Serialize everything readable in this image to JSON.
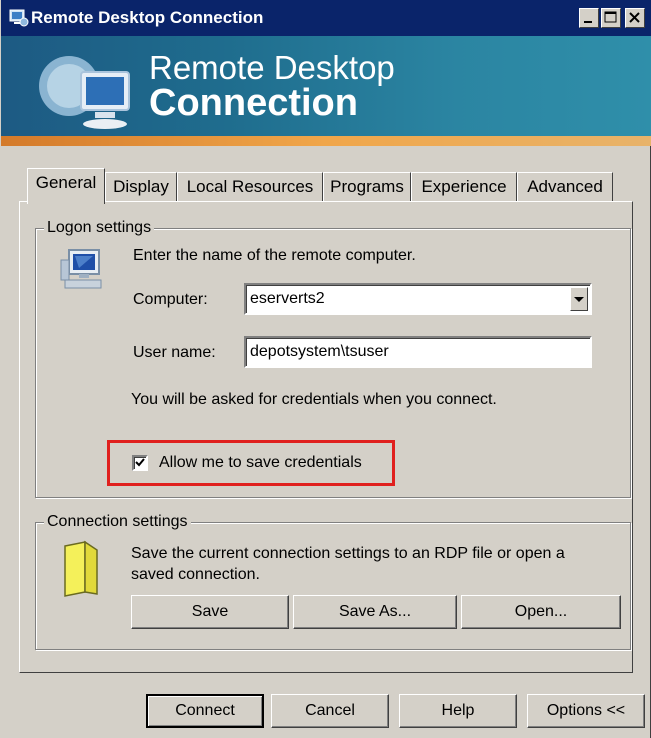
{
  "window": {
    "title": "Remote Desktop Connection",
    "banner_line1": "Remote Desktop",
    "banner_line2": "Connection",
    "controls": {
      "minimize_icon": "minimize-icon",
      "maximize_icon": "maximize-icon",
      "close_icon": "close-icon"
    }
  },
  "tabs": [
    {
      "label": "General",
      "active": true
    },
    {
      "label": "Display"
    },
    {
      "label": "Local Resources"
    },
    {
      "label": "Programs"
    },
    {
      "label": "Experience"
    },
    {
      "label": "Advanced"
    }
  ],
  "logon": {
    "group_label": "Logon settings",
    "intro": "Enter the name of the remote computer.",
    "computer_label": "Computer:",
    "computer_value": "eserverts2",
    "username_label": "User name:",
    "username_value": "depotsystem\\tsuser",
    "credentials_note": "You will be asked for credentials when you connect.",
    "save_credentials_label": "Allow me to save credentials",
    "save_credentials_checked": true
  },
  "connection": {
    "group_label": "Connection settings",
    "description_line1": "Save the current connection settings to an RDP file or open a",
    "description_line2": "saved connection.",
    "save_label": "Save",
    "save_as_label": "Save As...",
    "open_label": "Open..."
  },
  "footer": {
    "connect_label": "Connect",
    "cancel_label": "Cancel",
    "help_label": "Help",
    "options_label": "Options <<"
  },
  "colors": {
    "titlebar": "#0a246a",
    "highlight": "#e0201e",
    "face": "#d4d0c8"
  }
}
